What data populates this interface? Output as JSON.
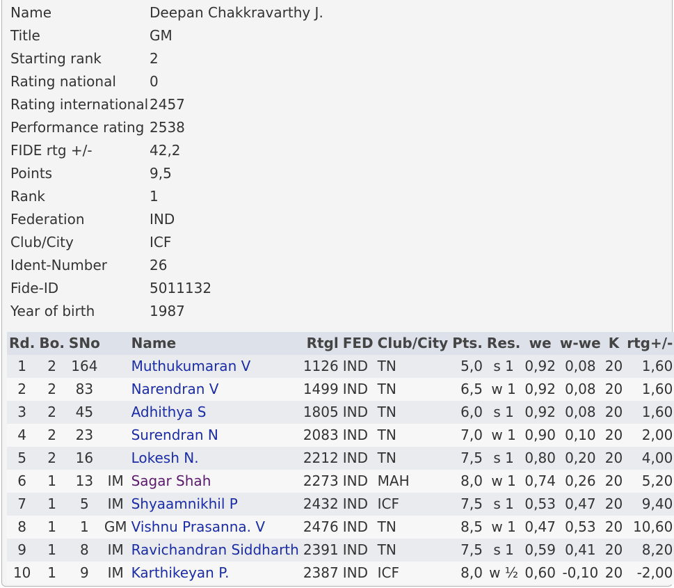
{
  "player_info": [
    {
      "label": "Name",
      "value": "Deepan Chakkravarthy J."
    },
    {
      "label": "Title",
      "value": "GM"
    },
    {
      "label": "Starting rank",
      "value": "2"
    },
    {
      "label": "Rating national",
      "value": "0"
    },
    {
      "label": "Rating international",
      "value": "2457"
    },
    {
      "label": "Performance rating",
      "value": "2538"
    },
    {
      "label": "FIDE rtg +/-",
      "value": "42,2"
    },
    {
      "label": "Points",
      "value": "9,5"
    },
    {
      "label": "Rank",
      "value": "1"
    },
    {
      "label": "Federation",
      "value": "IND"
    },
    {
      "label": "Club/City",
      "value": "ICF"
    },
    {
      "label": "Ident-Number",
      "value": "26"
    },
    {
      "label": "Fide-ID",
      "value": "5011132"
    },
    {
      "label": "Year of birth",
      "value": "1987"
    }
  ],
  "games_table": {
    "headers": [
      "Rd.",
      "Bo.",
      "SNo",
      "",
      "Name",
      "Rtgl",
      "FED",
      "Club/City",
      "Pts.",
      "Res.",
      "we",
      "w-we",
      "K",
      "rtg+/-"
    ],
    "rows": [
      [
        "1",
        "2",
        "164",
        "",
        "Muthukumaran V",
        "1126",
        "IND",
        "TN",
        "5,0",
        "s 1",
        "0,92",
        "0,08",
        "20",
        "1,60"
      ],
      [
        "2",
        "2",
        "83",
        "",
        "Narendran V",
        "1499",
        "IND",
        "TN",
        "6,5",
        "w 1",
        "0,92",
        "0,08",
        "20",
        "1,60"
      ],
      [
        "3",
        "2",
        "45",
        "",
        "Adhithya S",
        "1805",
        "IND",
        "TN",
        "6,0",
        "s 1",
        "0,92",
        "0,08",
        "20",
        "1,60"
      ],
      [
        "4",
        "2",
        "23",
        "",
        "Surendran N",
        "2083",
        "IND",
        "TN",
        "7,0",
        "w 1",
        "0,90",
        "0,10",
        "20",
        "2,00"
      ],
      [
        "5",
        "2",
        "16",
        "",
        "Lokesh N.",
        "2212",
        "IND",
        "TN",
        "7,5",
        "s 1",
        "0,80",
        "0,20",
        "20",
        "4,00"
      ],
      [
        "6",
        "1",
        "13",
        "IM",
        "Sagar Shah",
        "2273",
        "IND",
        "MAH",
        "8,0",
        "w 1",
        "0,74",
        "0,26",
        "20",
        "5,20"
      ],
      [
        "7",
        "1",
        "5",
        "IM",
        "Shyaamnikhil P",
        "2432",
        "IND",
        "ICF",
        "7,5",
        "s 1",
        "0,53",
        "0,47",
        "20",
        "9,40"
      ],
      [
        "8",
        "1",
        "1",
        "GM",
        "Vishnu Prasanna. V",
        "2476",
        "IND",
        "TN",
        "8,5",
        "w 1",
        "0,47",
        "0,53",
        "20",
        "10,60"
      ],
      [
        "9",
        "1",
        "8",
        "IM",
        "Ravichandran Siddharth",
        "2391",
        "IND",
        "TN",
        "7,5",
        "s 1",
        "0,59",
        "0,41",
        "20",
        "8,20"
      ],
      [
        "10",
        "1",
        "9",
        "IM",
        "Karthikeyan P.",
        "2387",
        "IND",
        "ICF",
        "8,0",
        "w ½",
        "0,60",
        "-0,10",
        "20",
        "-2,00"
      ]
    ],
    "visited_row_index": 5
  },
  "colors": {
    "link": "#1b2ca8",
    "visited_link": "#5c1a6e",
    "header_bg": "#dde2ea",
    "row_odd": "#e9ebef",
    "row_even": "#f7f7f7"
  }
}
